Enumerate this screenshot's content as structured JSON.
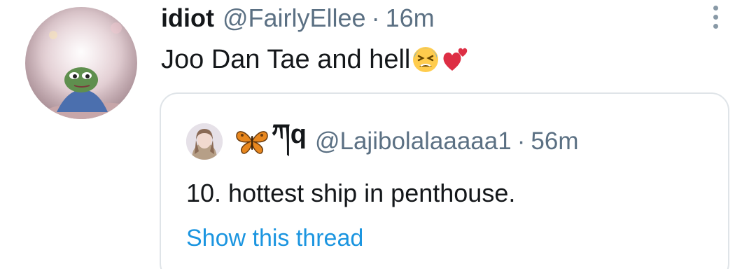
{
  "tweet": {
    "display_name": "idiot",
    "handle": "@FairlyEllee",
    "separator": "·",
    "time": "16m",
    "text": "Joo Dan Tae and hell",
    "emojis": [
      "tired-face-emoji",
      "two-hearts-emoji"
    ]
  },
  "quoted_tweet": {
    "display_name": "ཀq",
    "name_emoji": "butterfly-emoji",
    "handle": "@Lajibolalaaaaa1",
    "separator": "·",
    "time": "56m",
    "text": "10. hottest ship in penthouse.",
    "thread_link": "Show this thread"
  },
  "colors": {
    "text_primary": "#14171a",
    "text_secondary": "#5b7083",
    "link": "#1b95e0",
    "border": "#dfe4e8"
  }
}
